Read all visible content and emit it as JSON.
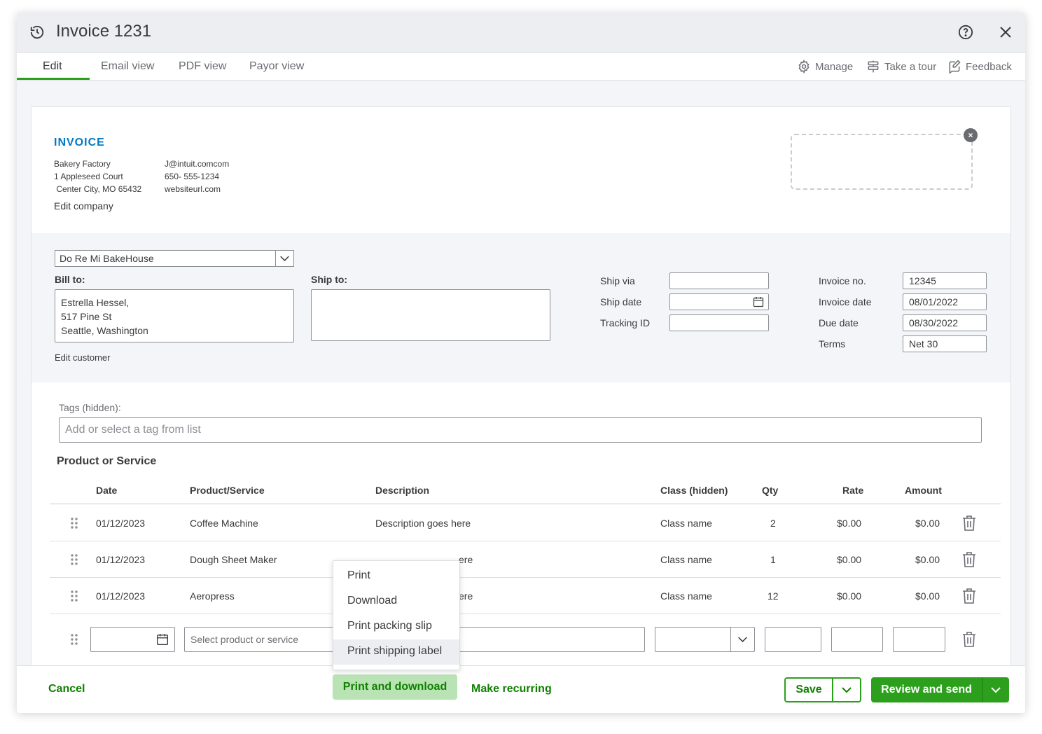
{
  "window": {
    "title": "Invoice 1231"
  },
  "tabs": [
    "Edit",
    "Email view",
    "PDF view",
    "Payor view"
  ],
  "tools": {
    "manage": "Manage",
    "tour": "Take a tour",
    "feedback": "Feedback"
  },
  "company": {
    "heading": "INVOICE",
    "name": "Bakery Factory",
    "address1": "1 Appleseed Court",
    "address2": " Center City, MO 65432",
    "email": "J@intuit.comcom",
    "phone": "650- 555-1234",
    "website": "websiteurl.com",
    "edit_link": "Edit company"
  },
  "customer": {
    "selected": "Do Re Mi BakeHouse",
    "bill_to_label": "Bill to:",
    "bill_to_lines": [
      "Estrella Hessel,",
      "517 Pine St",
      "Seattle, Washington"
    ],
    "ship_to_label": "Ship to:",
    "edit_link": "Edit customer"
  },
  "shipping": {
    "ship_via_label": "Ship via",
    "ship_date_label": "Ship date",
    "tracking_label": "Tracking ID"
  },
  "invoice_meta": {
    "no_label": "Invoice no.",
    "no": "12345",
    "date_label": "Invoice date",
    "date": "08/01/2022",
    "due_label": "Due date",
    "due": "08/30/2022",
    "terms_label": "Terms",
    "terms": "Net 30"
  },
  "tags": {
    "label": "Tags (hidden):",
    "placeholder": "Add or select a tag from list"
  },
  "products": {
    "section_title": "Product or Service",
    "headers": [
      "Date",
      "Product/Service",
      "Description",
      "Class (hidden)",
      "Qty",
      "Rate",
      "Amount"
    ],
    "rows": [
      {
        "date": "01/12/2023",
        "product": "Coffee Machine",
        "description": "Description goes here",
        "class": "Class name",
        "qty": "2",
        "rate": "$0.00",
        "amount": "$0.00"
      },
      {
        "date": "01/12/2023",
        "product": "Dough Sheet Maker",
        "description": "ere",
        "class": "Class name",
        "qty": "1",
        "rate": "$0.00",
        "amount": "$0.00"
      },
      {
        "date": "01/12/2023",
        "product": "Aeropress",
        "description": "ere",
        "class": "Class name",
        "qty": "12",
        "rate": "$0.00",
        "amount": "$0.00"
      }
    ],
    "new_row_placeholder": "Select product or service"
  },
  "print_menu": {
    "items": [
      "Print",
      "Download",
      "Print packing slip",
      "Print shipping label"
    ],
    "highlighted": "Print shipping label"
  },
  "footer": {
    "cancel": "Cancel",
    "print_download": "Print and download",
    "recurring": "Make recurring",
    "save": "Save",
    "review_send": "Review and send"
  },
  "colors": {
    "accent_green": "#2ca01c",
    "link_blue": "#0077c5",
    "button_text_green": "#108000"
  }
}
